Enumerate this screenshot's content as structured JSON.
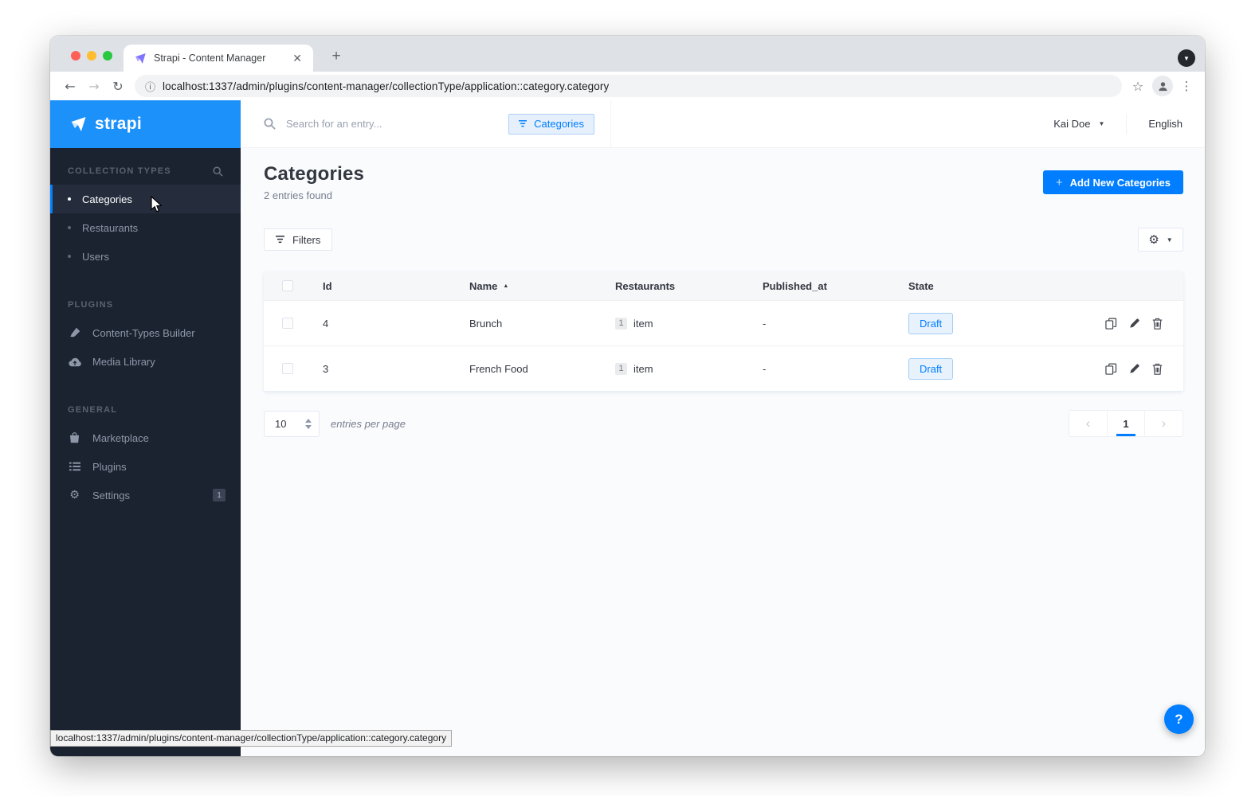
{
  "browser": {
    "tab_title": "Strapi - Content Manager",
    "url": "localhost:1337/admin/plugins/content-manager/collectionType/application::category.category",
    "status_url": "localhost:1337/admin/plugins/content-manager/collectionType/application::category.category"
  },
  "sidebar": {
    "logo_text": "strapi",
    "sections": [
      {
        "title": "COLLECTION TYPES",
        "items": [
          {
            "label": "Categories"
          },
          {
            "label": "Restaurants"
          },
          {
            "label": "Users"
          }
        ]
      },
      {
        "title": "PLUGINS",
        "items": [
          {
            "label": "Content-Types Builder"
          },
          {
            "label": "Media Library"
          }
        ]
      },
      {
        "title": "GENERAL",
        "items": [
          {
            "label": "Marketplace"
          },
          {
            "label": "Plugins"
          },
          {
            "label": "Settings",
            "badge": "1"
          }
        ]
      }
    ]
  },
  "header": {
    "search_placeholder": "Search for an entry...",
    "filter_chip": "Categories",
    "user": "Kai Doe",
    "language": "English"
  },
  "page": {
    "title": "Categories",
    "subtitle": "2 entries found",
    "add_button": "Add New Categories",
    "filters_button": "Filters",
    "table": {
      "columns": [
        "Id",
        "Name",
        "Restaurants",
        "Published_at",
        "State"
      ],
      "sorted_column": "Name",
      "rows": [
        {
          "id": "4",
          "name": "Brunch",
          "count": "1",
          "count_label": "item",
          "published_at": "-",
          "state": "Draft"
        },
        {
          "id": "3",
          "name": "French Food",
          "count": "1",
          "count_label": "item",
          "published_at": "-",
          "state": "Draft"
        }
      ]
    },
    "footer": {
      "per_page": "10",
      "per_page_label": "entries per page",
      "page": "1"
    },
    "help_label": "?"
  },
  "colors": {
    "primary": "#007eff",
    "logo_bg": "#1c91fa",
    "sidebar_bg": "#1c2330",
    "draft_text": "#007eff"
  }
}
